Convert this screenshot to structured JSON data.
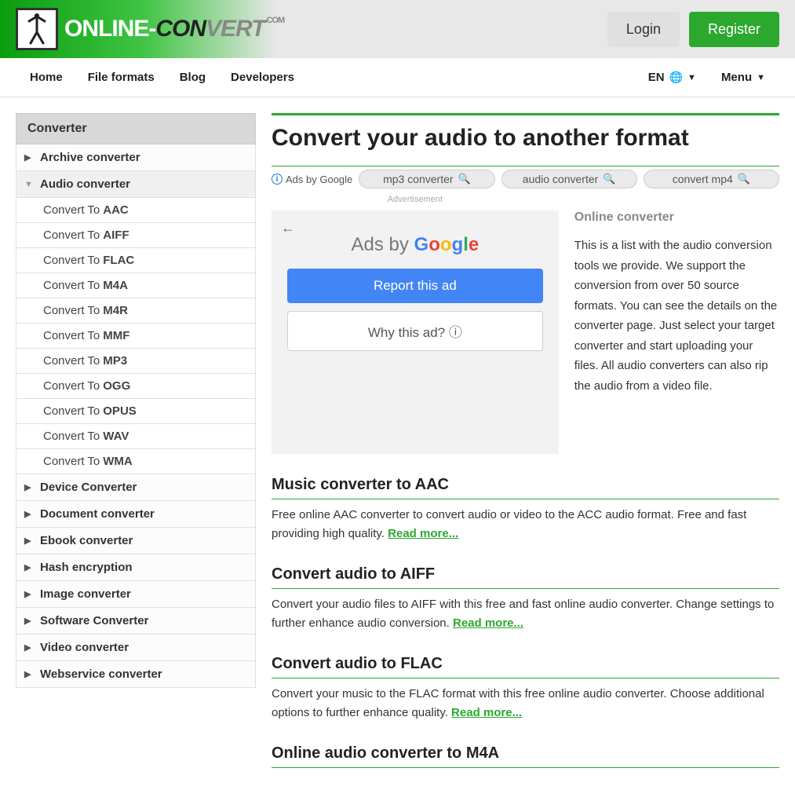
{
  "header": {
    "logo_white": "ONLINE-",
    "logo_black": "CON",
    "logo_light": "VERT",
    "logo_ext": ".COM",
    "login": "Login",
    "register": "Register"
  },
  "nav": {
    "home": "Home",
    "file_formats": "File formats",
    "blog": "Blog",
    "developers": "Developers",
    "lang": "EN",
    "menu": "Menu"
  },
  "sidebar": {
    "title": "Converter",
    "categories": [
      {
        "label": "Archive converter",
        "expanded": false
      },
      {
        "label": "Audio converter",
        "expanded": true
      },
      {
        "label": "Device Converter",
        "expanded": false
      },
      {
        "label": "Document converter",
        "expanded": false
      },
      {
        "label": "Ebook converter",
        "expanded": false
      },
      {
        "label": "Hash encryption",
        "expanded": false
      },
      {
        "label": "Image converter",
        "expanded": false
      },
      {
        "label": "Software Converter",
        "expanded": false
      },
      {
        "label": "Video converter",
        "expanded": false
      },
      {
        "label": "Webservice converter",
        "expanded": false
      }
    ],
    "audio_subs": [
      {
        "pre": "Convert To ",
        "fmt": "AAC"
      },
      {
        "pre": "Convert To ",
        "fmt": "AIFF"
      },
      {
        "pre": "Convert To ",
        "fmt": "FLAC"
      },
      {
        "pre": "Convert To ",
        "fmt": "M4A"
      },
      {
        "pre": "Convert To ",
        "fmt": "M4R"
      },
      {
        "pre": "Convert To ",
        "fmt": "MMF"
      },
      {
        "pre": "Convert To ",
        "fmt": "MP3"
      },
      {
        "pre": "Convert To ",
        "fmt": "OGG"
      },
      {
        "pre": "Convert To ",
        "fmt": "OPUS"
      },
      {
        "pre": "Convert To ",
        "fmt": "WAV"
      },
      {
        "pre": "Convert To ",
        "fmt": "WMA"
      }
    ]
  },
  "page": {
    "title": "Convert your audio to another format",
    "ads_label": "Ads by Google",
    "ad_chips": [
      "mp3 converter",
      "audio converter",
      "convert mp4"
    ],
    "advert_caption": "Advertisement",
    "ad_box_title_pre": "Ads by ",
    "ad_report": "Report this ad",
    "ad_why": "Why this ad? ⓘ",
    "desc_title": "Online converter",
    "desc_text": "This is a list with the audio conversion tools we provide. We support the conversion from over 50 source formats. You can see the details on the converter page. Just select your target converter and start uploading your files. All audio converters can also rip the audio from a video file.",
    "sections": [
      {
        "title": "Music converter to AAC",
        "desc": "Free online AAC converter to convert audio or video to the ACC audio format. Free and fast providing high quality. ",
        "more": "Read more..."
      },
      {
        "title": "Convert audio to AIFF",
        "desc": "Convert your audio files to AIFF with this free and fast online audio converter. Change settings to further enhance audio conversion. ",
        "more": "Read more..."
      },
      {
        "title": "Convert audio to FLAC",
        "desc": "Convert your music to the FLAC format with this free online audio converter. Choose additional options to further enhance quality. ",
        "more": "Read more..."
      },
      {
        "title": "Online audio converter to M4A",
        "desc": "",
        "more": ""
      }
    ]
  }
}
